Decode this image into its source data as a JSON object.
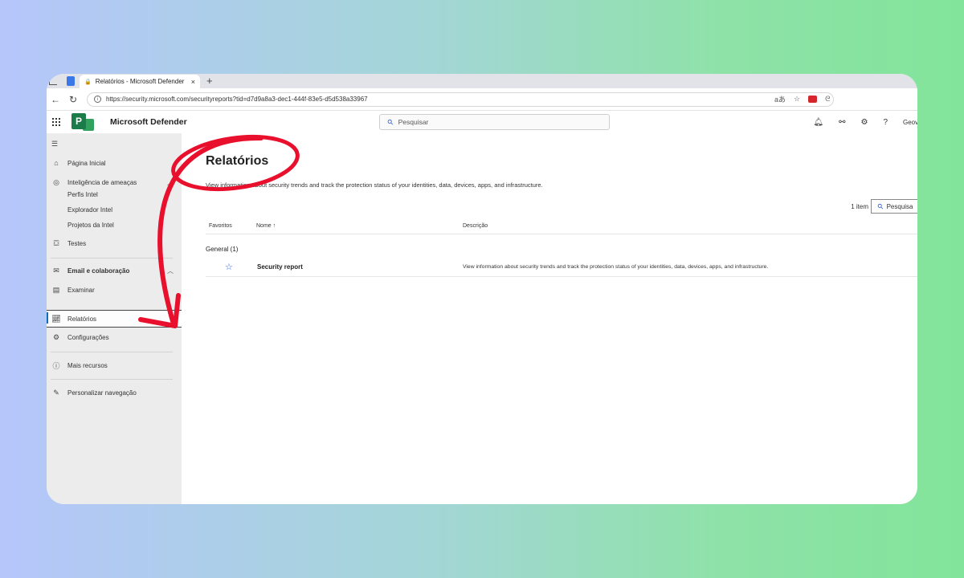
{
  "browser": {
    "tab_title": "Relatórios - Microsoft Defender",
    "tab_close": "×",
    "new_tab": "+",
    "url": "https://security.microsoft.com/securityreports?tid=d7d9a8a3-dec1-444f-83e5-d5d538a33967",
    "reader_label": "aあ"
  },
  "header": {
    "app_name": "Microsoft Defender",
    "search_placeholder": "Pesquisar",
    "help": "?",
    "user_partial": "Geov"
  },
  "sidebar": {
    "items": [
      {
        "label": "Página Inicial",
        "icon": "home-icon"
      },
      {
        "label": "Inteligência de ameaças",
        "icon": "threat-intel-icon"
      },
      {
        "label": "Testes",
        "icon": "tests-icon"
      },
      {
        "label": "Email e colaboração",
        "icon": "mail-icon"
      },
      {
        "label": "Examinar",
        "icon": "review-icon"
      },
      {
        "label": "Relatórios",
        "icon": "chart-icon"
      },
      {
        "label": "Configurações",
        "icon": "gear-icon"
      },
      {
        "label": "Mais recursos",
        "icon": "info-icon"
      },
      {
        "label": "Personalizar navegação",
        "icon": "pencil-icon"
      }
    ],
    "sub_items": [
      "Perfis Intel",
      "Explorador Intel",
      "Projetos da Intel"
    ],
    "active": "Relatórios"
  },
  "main": {
    "title": "Relatórios",
    "description": "View information about security trends and track the protection status of your identities, data, devices, apps, and infrastructure.",
    "count": "1 item",
    "table_search": "Pesquisa",
    "columns": [
      "Favoritos",
      "Nome ↑",
      "Descrição"
    ],
    "group": "General (1)",
    "rows": [
      {
        "name": "Security report",
        "description": "View information about security trends and track the protection status of your identities, data, devices, apps, and infrastructure."
      }
    ]
  },
  "colors": {
    "accent": "#0f6cbd",
    "annotation": "#e8102c",
    "brand_green": "#1b7c4a"
  }
}
